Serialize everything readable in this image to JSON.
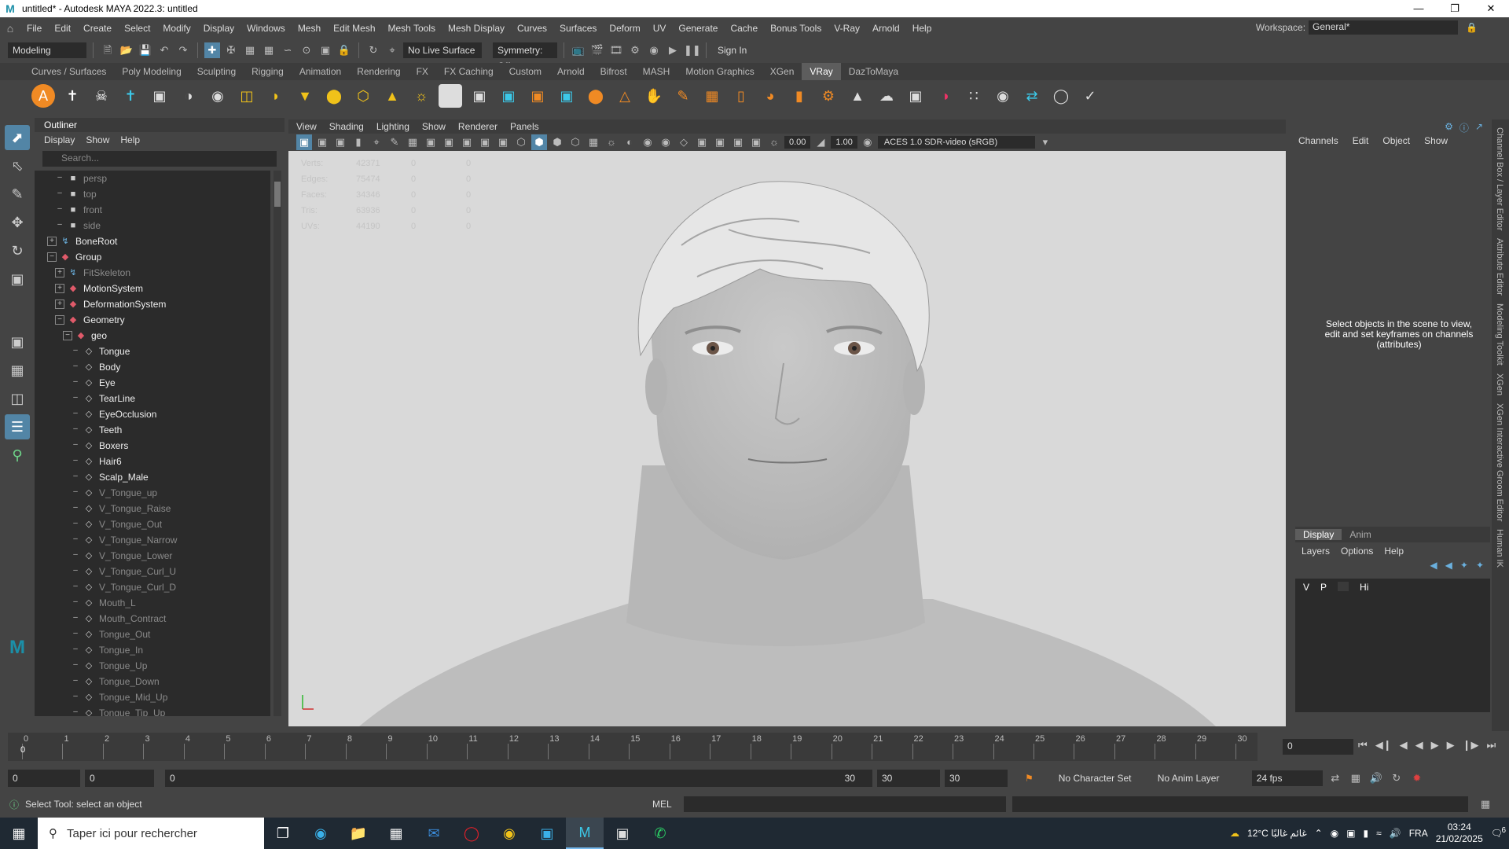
{
  "app": {
    "title": "untitled* - Autodesk MAYA 2022.3: untitled",
    "logo": "M"
  },
  "menubar": {
    "items": [
      "File",
      "Edit",
      "Create",
      "Select",
      "Modify",
      "Display",
      "Windows",
      "Mesh",
      "Edit Mesh",
      "Mesh Tools",
      "Mesh Display",
      "Curves",
      "Surfaces",
      "Deform",
      "UV",
      "Generate",
      "Cache",
      "Bonus Tools",
      "V-Ray",
      "Arnold",
      "Help"
    ],
    "workspace_label": "Workspace:",
    "workspace_value": "General*"
  },
  "statusline": {
    "mode": "Modeling",
    "live_surface": "No Live Surface",
    "symmetry": "Symmetry: Off",
    "sign_in": "Sign In"
  },
  "shelf": {
    "tabs": [
      "Curves / Surfaces",
      "Poly Modeling",
      "Sculpting",
      "Rigging",
      "Animation",
      "Rendering",
      "FX",
      "FX Caching",
      "Custom",
      "Arnold",
      "Bifrost",
      "MASH",
      "Motion Graphics",
      "XGen",
      "VRay",
      "DazToMaya"
    ],
    "active_tab": "VRay"
  },
  "outliner": {
    "title": "Outliner",
    "menu": [
      "Display",
      "Show",
      "Help"
    ],
    "search_placeholder": "Search...",
    "items": [
      {
        "label": "persp",
        "indent": 1,
        "expand": "",
        "icon": "camera-icon",
        "dim": true
      },
      {
        "label": "top",
        "indent": 1,
        "expand": "",
        "icon": "camera-icon",
        "dim": true
      },
      {
        "label": "front",
        "indent": 1,
        "expand": "",
        "icon": "camera-icon",
        "dim": true
      },
      {
        "label": "side",
        "indent": 1,
        "expand": "",
        "icon": "camera-icon",
        "dim": true
      },
      {
        "label": "BoneRoot",
        "indent": 0,
        "expand": "+",
        "icon": "joint-icon",
        "dim": false
      },
      {
        "label": "Group",
        "indent": 0,
        "expand": "−",
        "icon": "transform-icon",
        "dim": false
      },
      {
        "label": "FitSkeleton",
        "indent": 1,
        "expand": "+",
        "icon": "joint-icon",
        "dim": true
      },
      {
        "label": "MotionSystem",
        "indent": 1,
        "expand": "+",
        "icon": "transform-icon",
        "dim": false
      },
      {
        "label": "DeformationSystem",
        "indent": 1,
        "expand": "+",
        "icon": "transform-icon",
        "dim": false
      },
      {
        "label": "Geometry",
        "indent": 1,
        "expand": "−",
        "icon": "transform-icon",
        "dim": false
      },
      {
        "label": "geo",
        "indent": 2,
        "expand": "−",
        "icon": "transform-icon",
        "dim": false
      },
      {
        "label": "Tongue",
        "indent": 3,
        "expand": "",
        "icon": "mesh-icon",
        "dim": false
      },
      {
        "label": "Body",
        "indent": 3,
        "expand": "",
        "icon": "mesh-icon",
        "dim": false
      },
      {
        "label": "Eye",
        "indent": 3,
        "expand": "",
        "icon": "mesh-icon",
        "dim": false
      },
      {
        "label": "TearLine",
        "indent": 3,
        "expand": "",
        "icon": "mesh-icon",
        "dim": false
      },
      {
        "label": "EyeOcclusion",
        "indent": 3,
        "expand": "",
        "icon": "mesh-icon",
        "dim": false
      },
      {
        "label": "Teeth",
        "indent": 3,
        "expand": "",
        "icon": "mesh-icon",
        "dim": false
      },
      {
        "label": "Boxers",
        "indent": 3,
        "expand": "",
        "icon": "mesh-icon",
        "dim": false
      },
      {
        "label": "Hair6",
        "indent": 3,
        "expand": "",
        "icon": "mesh-icon",
        "dim": false
      },
      {
        "label": "Scalp_Male",
        "indent": 3,
        "expand": "",
        "icon": "mesh-icon",
        "dim": false
      },
      {
        "label": "V_Tongue_up",
        "indent": 3,
        "expand": "",
        "icon": "mesh-icon",
        "dim": true
      },
      {
        "label": "V_Tongue_Raise",
        "indent": 3,
        "expand": "",
        "icon": "mesh-icon",
        "dim": true
      },
      {
        "label": "V_Tongue_Out",
        "indent": 3,
        "expand": "",
        "icon": "mesh-icon",
        "dim": true
      },
      {
        "label": "V_Tongue_Narrow",
        "indent": 3,
        "expand": "",
        "icon": "mesh-icon",
        "dim": true
      },
      {
        "label": "V_Tongue_Lower",
        "indent": 3,
        "expand": "",
        "icon": "mesh-icon",
        "dim": true
      },
      {
        "label": "V_Tongue_Curl_U",
        "indent": 3,
        "expand": "",
        "icon": "mesh-icon",
        "dim": true
      },
      {
        "label": "V_Tongue_Curl_D",
        "indent": 3,
        "expand": "",
        "icon": "mesh-icon",
        "dim": true
      },
      {
        "label": "Mouth_L",
        "indent": 3,
        "expand": "",
        "icon": "mesh-icon",
        "dim": true
      },
      {
        "label": "Mouth_Contract",
        "indent": 3,
        "expand": "",
        "icon": "mesh-icon",
        "dim": true
      },
      {
        "label": "Tongue_Out",
        "indent": 3,
        "expand": "",
        "icon": "mesh-icon",
        "dim": true
      },
      {
        "label": "Tongue_In",
        "indent": 3,
        "expand": "",
        "icon": "mesh-icon",
        "dim": true
      },
      {
        "label": "Tongue_Up",
        "indent": 3,
        "expand": "",
        "icon": "mesh-icon",
        "dim": true
      },
      {
        "label": "Tongue_Down",
        "indent": 3,
        "expand": "",
        "icon": "mesh-icon",
        "dim": true
      },
      {
        "label": "Tongue_Mid_Up",
        "indent": 3,
        "expand": "",
        "icon": "mesh-icon",
        "dim": true
      },
      {
        "label": "Tongue_Tip_Up",
        "indent": 3,
        "expand": "",
        "icon": "mesh-icon",
        "dim": true
      }
    ]
  },
  "viewport": {
    "menu": [
      "View",
      "Shading",
      "Lighting",
      "Show",
      "Renderer",
      "Panels"
    ],
    "exposure": "0.00",
    "gamma": "1.00",
    "colorspace": "ACES 1.0 SDR-video (sRGB)",
    "hud": [
      {
        "label": "Verts:",
        "v1": "42371",
        "v2": "0",
        "v3": "0"
      },
      {
        "label": "Edges:",
        "v1": "75474",
        "v2": "0",
        "v3": "0"
      },
      {
        "label": "Faces:",
        "v1": "34346",
        "v2": "0",
        "v3": "0"
      },
      {
        "label": "Tris:",
        "v1": "63936",
        "v2": "0",
        "v3": "0"
      },
      {
        "label": "UVs:",
        "v1": "44190",
        "v2": "0",
        "v3": "0"
      }
    ]
  },
  "channelbox": {
    "menu": [
      "Channels",
      "Edit",
      "Object",
      "Show"
    ],
    "message": "Select objects in the scene to view, edit and set keyframes on channels (attributes)"
  },
  "layers": {
    "tabs": [
      "Display",
      "Anim"
    ],
    "menu": [
      "Layers",
      "Options",
      "Help"
    ],
    "columns": [
      "V",
      "P",
      "",
      "Hi"
    ]
  },
  "rightstrip": [
    "Channel Box / Layer Editor",
    "Attribute Editor",
    "Modeling Toolkit",
    "XGen",
    "XGen Interactive Groom Editor",
    "Human IK"
  ],
  "timeline": {
    "ticks": [
      "0",
      "1",
      "2",
      "3",
      "4",
      "5",
      "6",
      "7",
      "8",
      "9",
      "10",
      "11",
      "12",
      "13",
      "14",
      "15",
      "16",
      "17",
      "18",
      "19",
      "20",
      "21",
      "22",
      "23",
      "24",
      "25",
      "26",
      "27",
      "28",
      "29",
      "30"
    ],
    "current_frame_label": "0",
    "current_frame": "0"
  },
  "range": {
    "start": "0",
    "playback_start": "0",
    "slider_start": "0",
    "slider_end": "30",
    "playback_end": "30",
    "end": "30",
    "character_set": "No Character Set",
    "anim_layer": "No Anim Layer",
    "fps": "24 fps"
  },
  "commandline": {
    "help": "Select Tool: select an object",
    "mel": "MEL"
  },
  "taskbar": {
    "search": "Taper ici pour rechercher",
    "weather": "12°C غائم غالبًا",
    "lang": "FRA",
    "time": "03:24",
    "date": "21/02/2025",
    "notif": "6"
  }
}
